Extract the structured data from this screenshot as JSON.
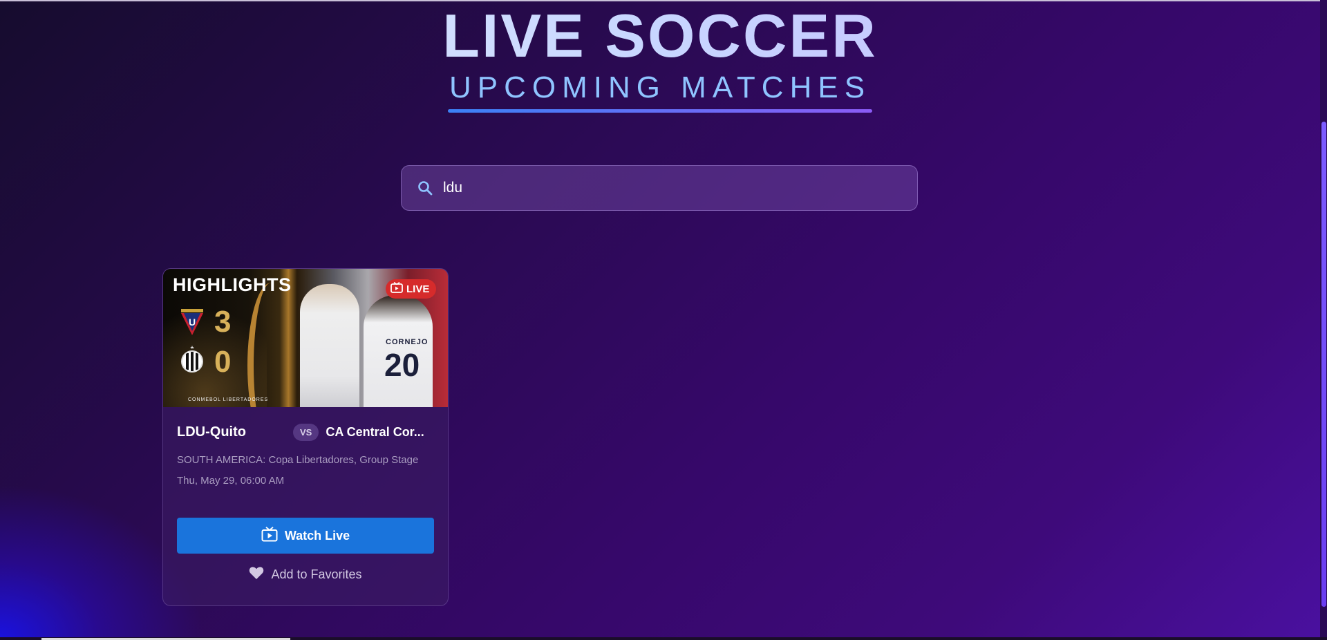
{
  "header": {
    "title": "LIVE SOCCER",
    "subtitle": "UPCOMING MATCHES"
  },
  "search": {
    "value": "ldu",
    "placeholder": "Search matches..."
  },
  "matches": [
    {
      "thumbnail": {
        "label": "HIGHLIGHTS",
        "live_badge": "LIVE",
        "home_score": "3",
        "away_score": "0",
        "jersey_number": "20",
        "jersey_name": "CORNEJO",
        "footer_text": "CONMEBOL LIBERTADORES"
      },
      "home_team": "LDU-Quito",
      "vs": "VS",
      "away_team": "CA Central Cor...",
      "league": "SOUTH AMERICA: Copa Libertadores, Group Stage",
      "datetime": "Thu, May 29, 06:00 AM",
      "watch_label": "Watch Live",
      "favorite_label": "Add to Favorites"
    }
  ],
  "colors": {
    "accent_blue": "#1a74dc",
    "live_red": "#d62b2b",
    "subtitle_blue": "#8fc4ff"
  }
}
